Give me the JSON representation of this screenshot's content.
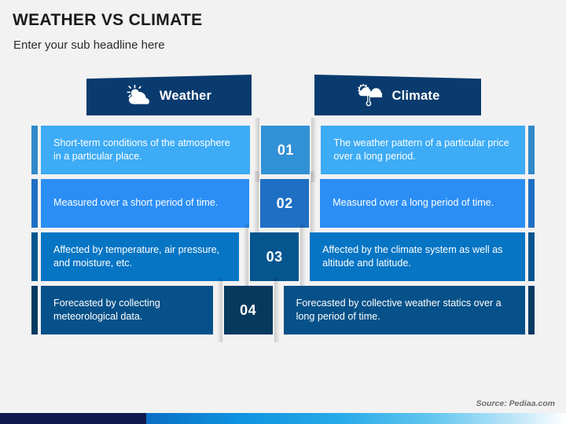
{
  "header": {
    "title": "WEATHER VS CLIMATE",
    "subtitle": "Enter your sub headline here"
  },
  "columns": {
    "left": {
      "label": "Weather",
      "icon": "sun-behind-cloud-icon"
    },
    "right": {
      "label": "Climate",
      "icon": "sun-cloud-thermometer-icon"
    }
  },
  "rows": [
    {
      "number": "01",
      "left": "Short-term conditions of the atmosphere in a particular place.",
      "right": "The weather pattern of a particular price over a long period.",
      "fill": "#3dabf5",
      "accent": "#3089c9",
      "number_fill": "#3191d6"
    },
    {
      "number": "02",
      "left": "Measured over a short period of time.",
      "right": "Measured over a long period of time.",
      "fill": "#2b8ef5",
      "accent": "#1f6fc4",
      "number_fill": "#1f6fc4"
    },
    {
      "number": "03",
      "left": "Affected by temperature, air pressure, and moisture, etc.",
      "right": "Affected by the climate system as well as altitude and latitude.",
      "fill": "#0675c4",
      "accent": "#05558f",
      "number_fill": "#05558f"
    },
    {
      "number": "04",
      "left": "Forecasted by collecting meteorological data.",
      "right": "Forecasted by collective weather statics over a long period of time.",
      "fill": "#065189",
      "accent": "#043a62",
      "number_fill": "#06395e"
    }
  ],
  "footer": {
    "source": "Source: Pediaa.com"
  },
  "palette": {
    "background": "#f2f2f2",
    "banner": "#0a3b6e",
    "bar_navy": "#111a4e",
    "bar_blue": "#0d93e0",
    "text_dark": "#1b1b1b"
  }
}
